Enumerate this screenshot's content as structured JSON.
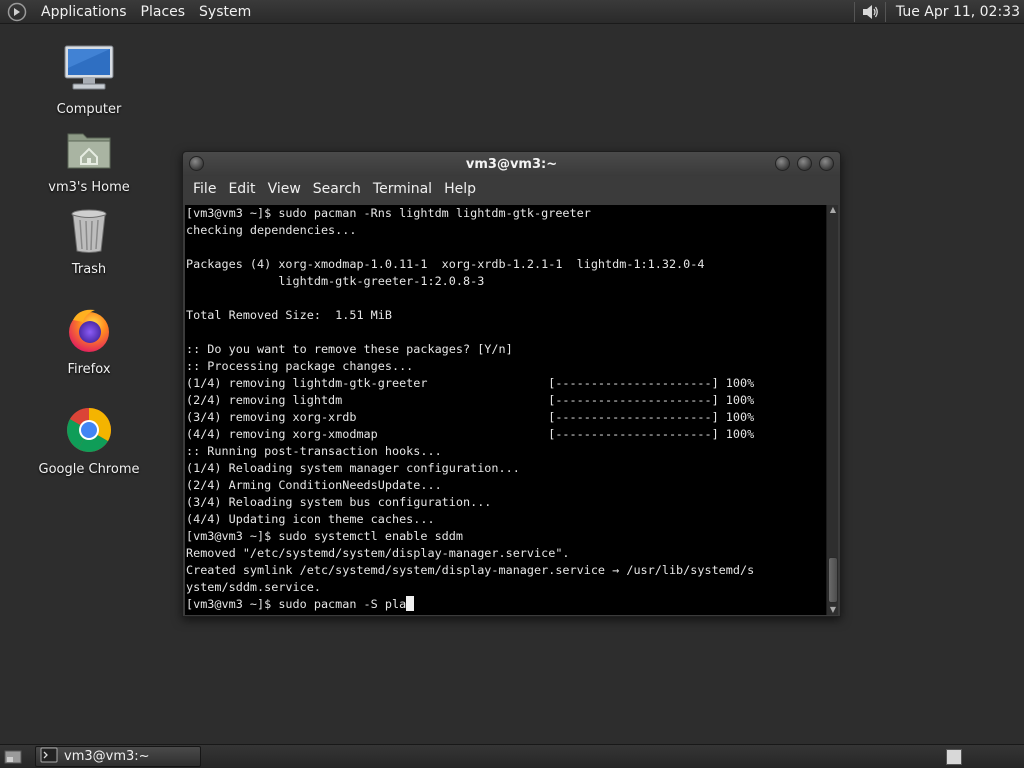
{
  "top_panel": {
    "menus": [
      "Applications",
      "Places",
      "System"
    ],
    "clock": "Tue Apr 11, 02:33",
    "volume_icon": "speaker-icon"
  },
  "desktop": {
    "icons": [
      {
        "label": "Computer",
        "icon": "computer-icon"
      },
      {
        "label": "vm3's Home",
        "icon": "home-folder-icon"
      },
      {
        "label": "Trash",
        "icon": "trash-icon"
      },
      {
        "label": "Firefox",
        "icon": "firefox-icon"
      },
      {
        "label": "Google Chrome",
        "icon": "chrome-icon"
      }
    ]
  },
  "terminal": {
    "title": "vm3@vm3:~",
    "menu": [
      "File",
      "Edit",
      "View",
      "Search",
      "Terminal",
      "Help"
    ],
    "lines": [
      "[vm3@vm3 ~]$ sudo pacman -Rns lightdm lightdm-gtk-greeter",
      "checking dependencies...",
      "",
      "Packages (4) xorg-xmodmap-1.0.11-1  xorg-xrdb-1.2.1-1  lightdm-1:1.32.0-4",
      "             lightdm-gtk-greeter-1:2.0.8-3",
      "",
      "Total Removed Size:  1.51 MiB",
      "",
      ":: Do you want to remove these packages? [Y/n]",
      ":: Processing package changes...",
      "(1/4) removing lightdm-gtk-greeter                 [----------------------] 100%",
      "(2/4) removing lightdm                             [----------------------] 100%",
      "(3/4) removing xorg-xrdb                           [----------------------] 100%",
      "(4/4) removing xorg-xmodmap                        [----------------------] 100%",
      ":: Running post-transaction hooks...",
      "(1/4) Reloading system manager configuration...",
      "(2/4) Arming ConditionNeedsUpdate...",
      "(3/4) Reloading system bus configuration...",
      "(4/4) Updating icon theme caches...",
      "[vm3@vm3 ~]$ sudo systemctl enable sddm",
      "Removed \"/etc/systemd/system/display-manager.service\".",
      "Created symlink /etc/systemd/system/display-manager.service → /usr/lib/systemd/s",
      "ystem/sddm.service."
    ],
    "prompt_line": "[vm3@vm3 ~]$ sudo pacman -S pla"
  },
  "bottom_panel": {
    "task_label": "vm3@vm3:~"
  }
}
